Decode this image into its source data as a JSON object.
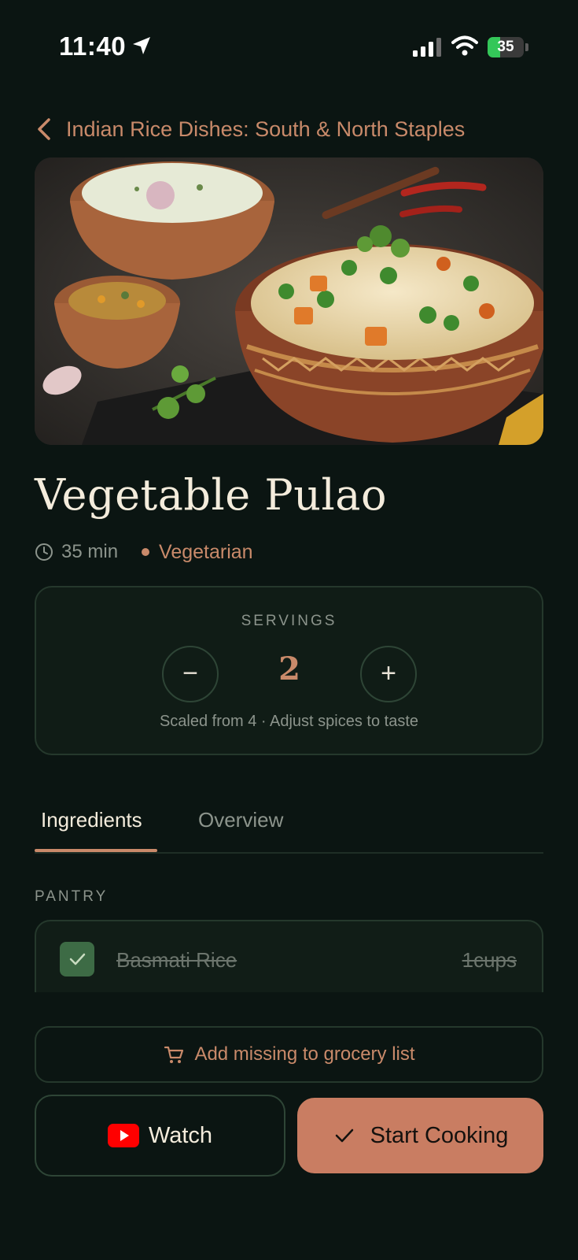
{
  "status_bar": {
    "time": "11:40",
    "battery_percent": 35,
    "battery_label": "35"
  },
  "header": {
    "back_title": "Indian Rice Dishes: South & North Staples"
  },
  "recipe": {
    "title": "Vegetable Pulao",
    "time": "35 min",
    "diet": "Vegetarian"
  },
  "servings": {
    "label": "SERVINGS",
    "minus": "−",
    "value": "2",
    "plus": "+",
    "note": "Scaled from 4 · Adjust spices to taste"
  },
  "tabs": [
    {
      "label": "Ingredients",
      "active": true
    },
    {
      "label": "Overview",
      "active": false
    }
  ],
  "section": {
    "label": "PANTRY"
  },
  "ingredients": [
    {
      "name": "Basmati Rice",
      "quantity": "1cups",
      "checked": true
    }
  ],
  "actions": {
    "grocery_label": "Add missing to grocery list",
    "watch_label": "Watch",
    "cook_label": "Start Cooking"
  },
  "colors": {
    "background": "#0b1512",
    "accent": "#c98a6a",
    "card_border": "#25382c",
    "check_green": "#3d6b45",
    "cook_button": "#c97d62",
    "youtube_red": "#ff0000"
  },
  "icons": [
    "location-arrow-icon",
    "signal-icon",
    "wifi-icon",
    "battery-icon",
    "chevron-left-icon",
    "clock-icon",
    "checkmark-icon",
    "cart-icon",
    "youtube-icon"
  ]
}
